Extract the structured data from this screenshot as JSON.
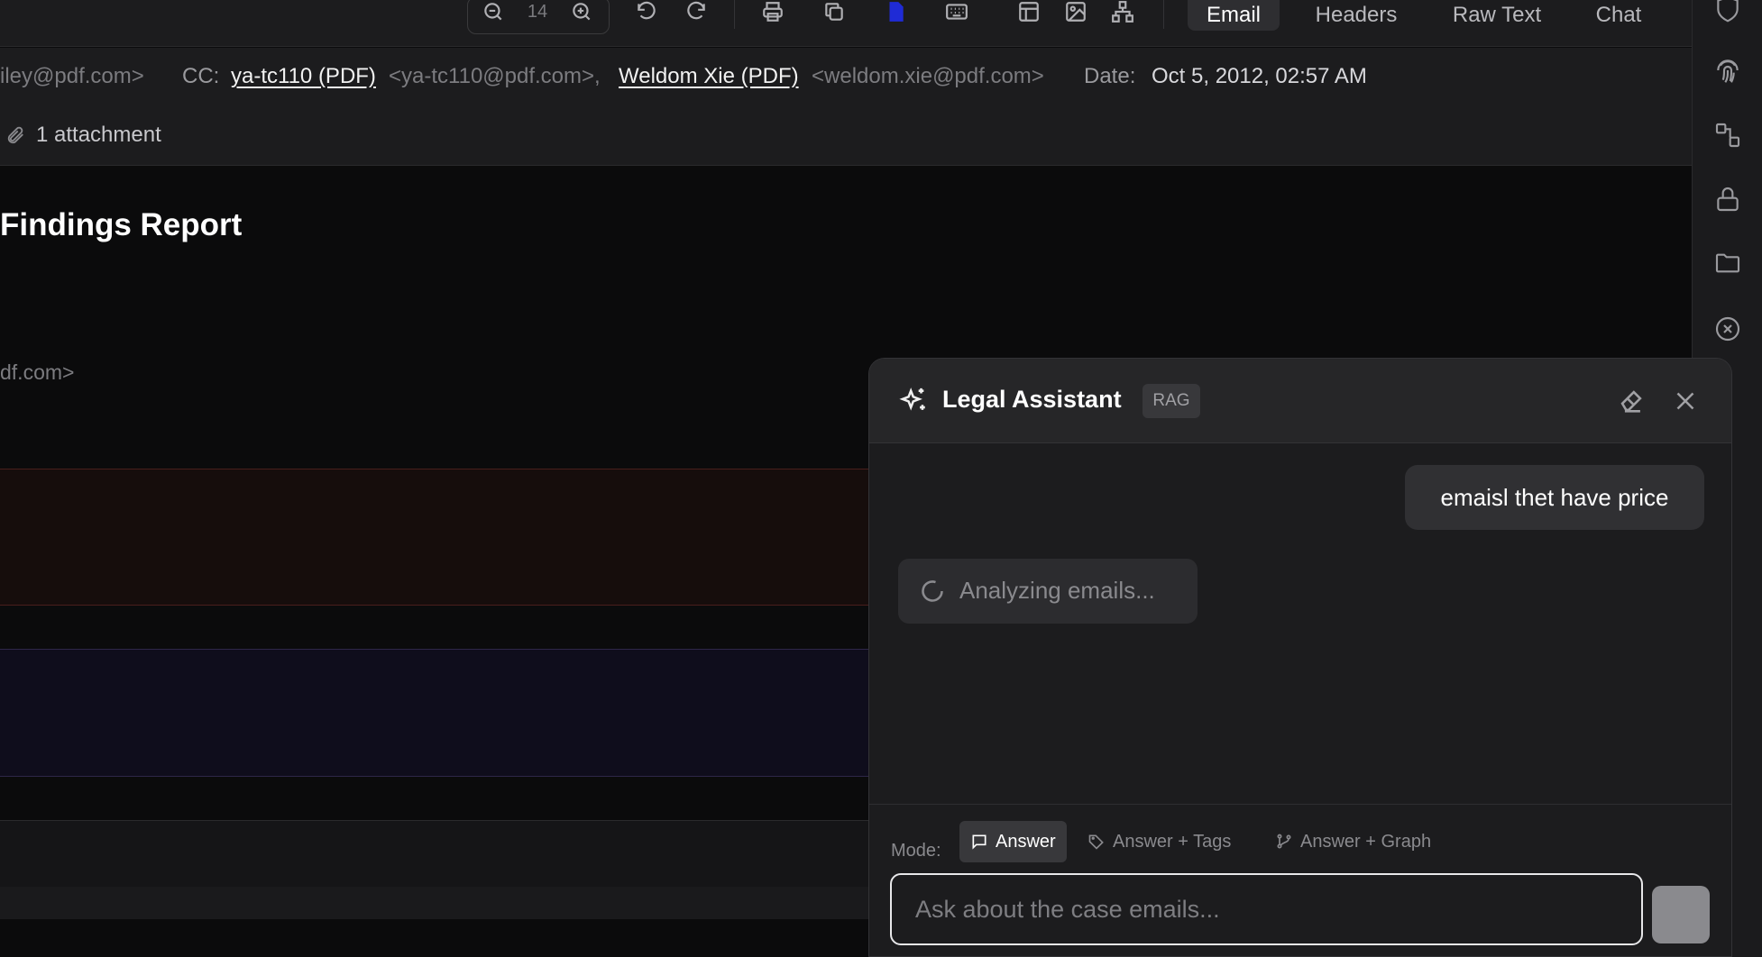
{
  "toolbar": {
    "zoom_value": "14",
    "view_tabs": [
      {
        "label": "Email",
        "active": true
      },
      {
        "label": "Headers",
        "active": false
      },
      {
        "label": "Raw Text",
        "active": false
      },
      {
        "label": "Chat",
        "active": false
      }
    ]
  },
  "email": {
    "from_partial": "iley@pdf.com>",
    "cc_label": "CC:",
    "cc": [
      {
        "name": "ya-tc110 (PDF)",
        "address": "<ya-tc110@pdf.com>,"
      },
      {
        "name": "Weldom Xie (PDF)",
        "address": "<weldom.xie@pdf.com>"
      }
    ],
    "date_label": "Date:",
    "date_value": "Oct 5, 2012, 02:57 AM",
    "attachments": "1 attachment",
    "body_title": "Findings Report",
    "body_email_partial": "df.com>"
  },
  "assistant": {
    "title": "Legal Assistant",
    "badge": "RAG",
    "user_message": "emaisl thet have price",
    "loading_text": "Analyzing emails...",
    "mode_label": "Mode:",
    "modes": [
      {
        "label": "Answer",
        "active": true
      },
      {
        "label": "Answer + Tags",
        "active": false
      },
      {
        "label": "Answer + Graph",
        "active": false
      }
    ],
    "input_placeholder": "Ask about the case emails..."
  },
  "colors": {
    "background": "#0b0b0c",
    "panel": "#1c1c1e",
    "active_tool": "#1f2bd6",
    "red_band": "#160d0c",
    "purple_band": "#0f0d1c"
  }
}
